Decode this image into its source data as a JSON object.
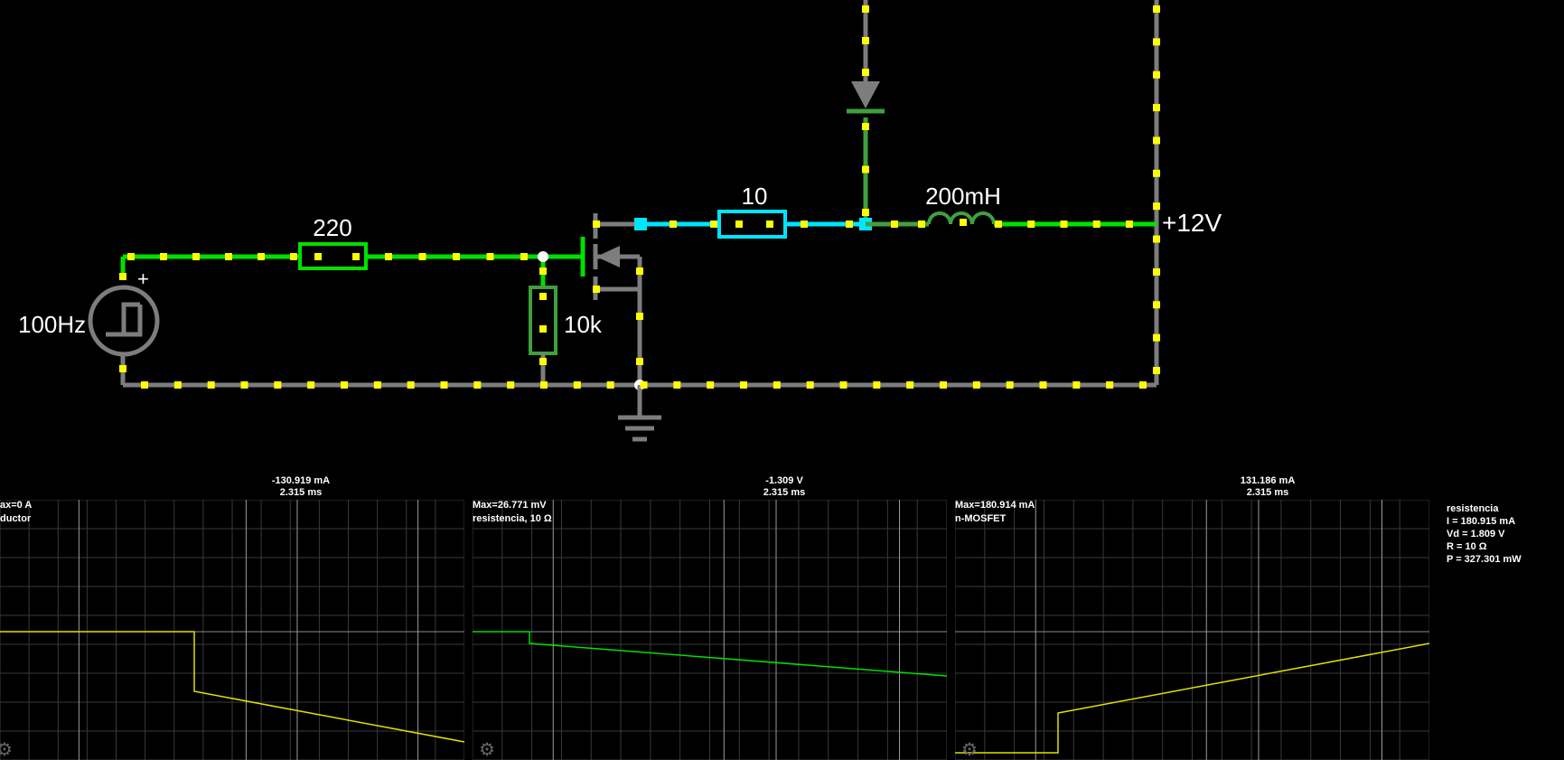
{
  "circuit": {
    "source_label": "100Hz",
    "source_polarity": "+",
    "r_input_label": "220",
    "r_gate_label": "10k",
    "r_load_label": "10",
    "inductor_label": "200mH",
    "supply_label": "+12V",
    "colors": {
      "green": "#00e000",
      "cyan": "#00e5ff",
      "gray": "#7d7d7d",
      "dark_green": "#3fa03f",
      "current_dot": "#ffff00"
    }
  },
  "scopes": [
    {
      "value": "-130.919 mA",
      "time": "2.315 ms",
      "max_label": "ax=0 A",
      "name_label": "ductor",
      "trace_color": "#e0e000"
    },
    {
      "value": "-1.309 V",
      "time": "2.315 ms",
      "max_label": "Max=26.771 mV",
      "name_label": "resistencia, 10 Ω",
      "trace_color": "#00e000"
    },
    {
      "value": "131.186 mA",
      "time": "2.315 ms",
      "max_label": "Max=180.914 mA",
      "name_label": "n-MOSFET",
      "trace_color": "#e0e000"
    }
  ],
  "info_panel": {
    "title": "resistencia",
    "current": "I = 180.915 mA",
    "voltage": "Vd = 1.809 V",
    "resistance": "R = 10 Ω",
    "power": "P = 327.301 mW"
  },
  "icons": {
    "scope_settings": "gear-icon"
  }
}
